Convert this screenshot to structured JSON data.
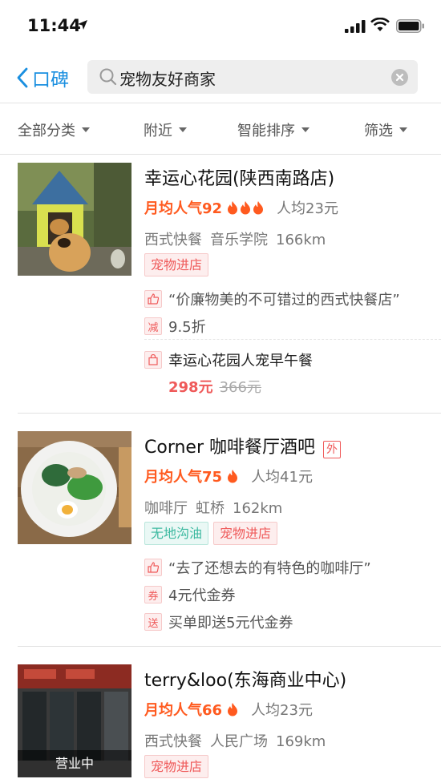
{
  "status_bar": {
    "time": "11:44"
  },
  "nav": {
    "back_label": "口碑",
    "search_query": "宠物友好商家"
  },
  "filters": [
    {
      "label": "全部分类"
    },
    {
      "label": "附近"
    },
    {
      "label": "智能排序"
    },
    {
      "label": "筛选"
    }
  ],
  "listings": [
    {
      "title": "幸运心花园(陕西南路店)",
      "popularity": "月均人气92",
      "flames": 3,
      "avg_price": "人均23元",
      "category": "西式快餐",
      "area": "音乐学院",
      "distance": "166km",
      "tags": [
        "宠物进店"
      ],
      "review_badge": "",
      "review": "“价廉物美的不可错过的西式快餐店”",
      "discount_badge": "减",
      "discount": "9.5折",
      "deal_title": "幸运心花园人宠早午餐",
      "deal_price": "298元",
      "deal_old_price": "366元"
    },
    {
      "title": "Corner 咖啡餐厅酒吧",
      "takeout_badge": "外",
      "popularity": "月均人气75",
      "flames": 1,
      "avg_price": "人均41元",
      "category": "咖啡厅",
      "area": "虹桥",
      "distance": "162km",
      "tags": [
        "无地沟油",
        "宠物进店"
      ],
      "review": "“去了还想去的有特色的咖啡厅”",
      "coupon_badge": "券",
      "coupon": "4元代金券",
      "gift_badge": "送",
      "gift": "买单即送5元代金券"
    },
    {
      "title": "terry&loo(东海商业中心)",
      "popularity": "月均人气66",
      "flames": 1,
      "avg_price": "人均23元",
      "category": "西式快餐",
      "area": "人民广场",
      "distance": "169km",
      "tags": [
        "宠物进店"
      ],
      "open_status": "营业中"
    }
  ]
}
